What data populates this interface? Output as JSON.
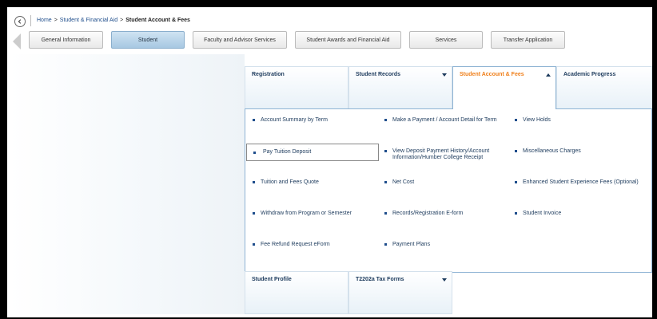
{
  "breadcrumb": {
    "home": "Home",
    "parent": "Student & Financial Aid",
    "current": "Student Account & Fees"
  },
  "tabs": [
    {
      "label": "General Information",
      "active": false
    },
    {
      "label": "Student",
      "active": true
    },
    {
      "label": "Faculty and Advisor Services",
      "active": false
    },
    {
      "label": "Student Awards and Financial Aid",
      "active": false
    },
    {
      "label": "Services",
      "active": false
    },
    {
      "label": "Transfer Application",
      "active": false
    }
  ],
  "categories": {
    "registration": "Registration",
    "student_records": "Student Records",
    "student_account": "Student Account & Fees",
    "academic_progress": "Academic Progress",
    "student_profile": "Student Profile",
    "t2202a": "T2202a Tax Forms"
  },
  "menu": {
    "col1": [
      "Account Summary by Term",
      "Pay Tuition Deposit",
      "Tuition and Fees Quote",
      "Withdraw from Program or Semester",
      "Fee Refund Request eForm"
    ],
    "col2": [
      "Make a Payment / Account Detail for Term",
      "View Deposit Payment History/Account Information/Humber College Receipt",
      "Net Cost",
      "Records/Registration E-form",
      "Payment Plans"
    ],
    "col3": [
      "View Holds",
      "Miscellaneous Charges",
      "Enhanced Student Experience Fees (Optional)",
      "Student Invoice"
    ]
  },
  "colors": {
    "accent": "#ef7f1a",
    "link": "#1f4e8c",
    "active_tab": "#a7c8e2"
  },
  "icons": {
    "back": "back-arrow-icon"
  }
}
